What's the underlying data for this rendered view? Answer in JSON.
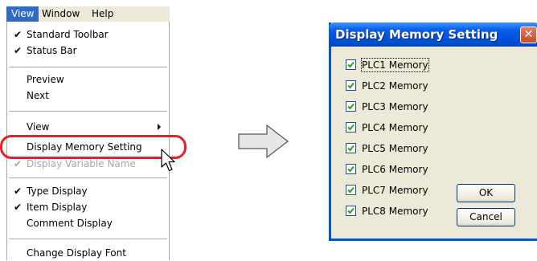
{
  "menubar": {
    "items": [
      {
        "label": "View",
        "active": true
      },
      {
        "label": "Window"
      },
      {
        "label": "Help"
      }
    ]
  },
  "view_menu": {
    "items": [
      {
        "label": "Standard Toolbar",
        "checked": true
      },
      {
        "label": "Status Bar",
        "checked": true
      },
      {
        "label": "Preview"
      },
      {
        "label": "Next"
      },
      {
        "label": "View",
        "submenu": true
      },
      {
        "label": "Display Memory Setting",
        "highlighted": true
      },
      {
        "label": "Display Variable Name",
        "checked": true,
        "disabled": true
      },
      {
        "label": "Type Display",
        "checked": true
      },
      {
        "label": "Item Display",
        "checked": true
      },
      {
        "label": "Comment Display"
      },
      {
        "label": "Change Display Font"
      }
    ]
  },
  "highlight_color": "#e8202a",
  "dialog": {
    "title": "Display Memory Setting",
    "close_icon": "close-x-icon",
    "checkboxes": [
      {
        "label": "PLC1 Memory",
        "checked": true,
        "focused": true
      },
      {
        "label": "PLC2 Memory",
        "checked": true
      },
      {
        "label": "PLC3 Memory",
        "checked": true
      },
      {
        "label": "PLC4 Memory",
        "checked": true
      },
      {
        "label": "PLC5 Memory",
        "checked": true
      },
      {
        "label": "PLC6 Memory",
        "checked": true
      },
      {
        "label": "PLC7 Memory",
        "checked": true
      },
      {
        "label": "PLC8 Memory",
        "checked": true
      }
    ],
    "ok_label": "OK",
    "cancel_label": "Cancel"
  }
}
